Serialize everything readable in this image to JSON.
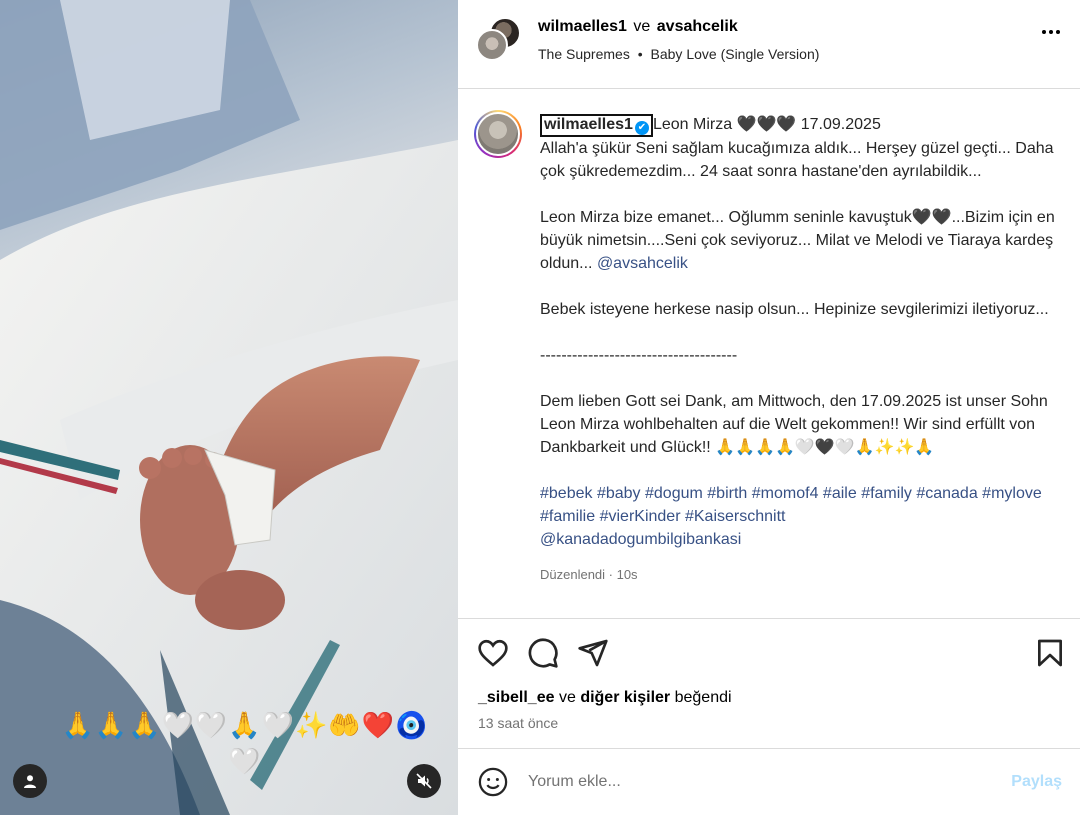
{
  "media": {
    "overlay_emoji": "🙏🙏🙏🤍🤍🙏🤍✨🤲❤️🧿🤍",
    "tag_icon": "user-icon",
    "mute_icon": "speaker-muted-icon"
  },
  "header": {
    "user1": "wilmaelles1",
    "ve": "ve",
    "user2": "avsahcelik",
    "artist": "The Supremes",
    "dot": "•",
    "song": "Baby Love (Single Version)"
  },
  "caption": {
    "username": "wilmaelles1",
    "verified": "✔",
    "title": "Leon Mirza 🖤🖤🖤 17.09.2025",
    "body": "Allah'a şükür Seni sağlam kucağımıza aldık... Herşey güzel geçti... Daha çok şükredemezdim... 24 saat sonra hastane'den ayrılabildik...\n\nLeon Mirza bize emanet... Oğlumm seninle kavuştuk🖤🖤...Bizim için en büyük nimetsin....Seni çok seviyoruz... Milat ve Melodi ve Tiaraya kardeş oldun... ",
    "mention": "@avsahcelik",
    "body2": "\n\nBebek isteyene herkese nasip olsun... Hepinize sevgilerimizi iletiyoruz...\n\n-------------------------------------\n\nDem lieben Gott sei Dank, am Mittwoch, den 17.09.2025 ist unser Sohn Leon Mirza wohlbehalten auf die Welt gekommen!! Wir sind erfüllt von Dankbarkeit und Glück!! 🙏🙏🙏🙏🤍🖤🤍🙏✨✨🙏",
    "hashtags": [
      "#bebek",
      "#baby",
      "#dogum",
      "#birth",
      "#momof4",
      "#aile",
      "#family",
      "#canada",
      "#mylove",
      "#familie",
      "#vierKinder",
      "#Kaiserschnitt"
    ],
    "tag_mention": "@kanadadogumbilgibankasi",
    "edited": "Düzenlendi · 10s"
  },
  "actions": {
    "liked_by_user": "_sibell_ee",
    "ve": "ve",
    "others": "diğer kişiler",
    "liked_suffix": "beğendi",
    "time": "13 saat önce"
  },
  "comment": {
    "placeholder": "Yorum ekle...",
    "post_label": "Paylaş",
    "post_color": "#b2dffc"
  }
}
